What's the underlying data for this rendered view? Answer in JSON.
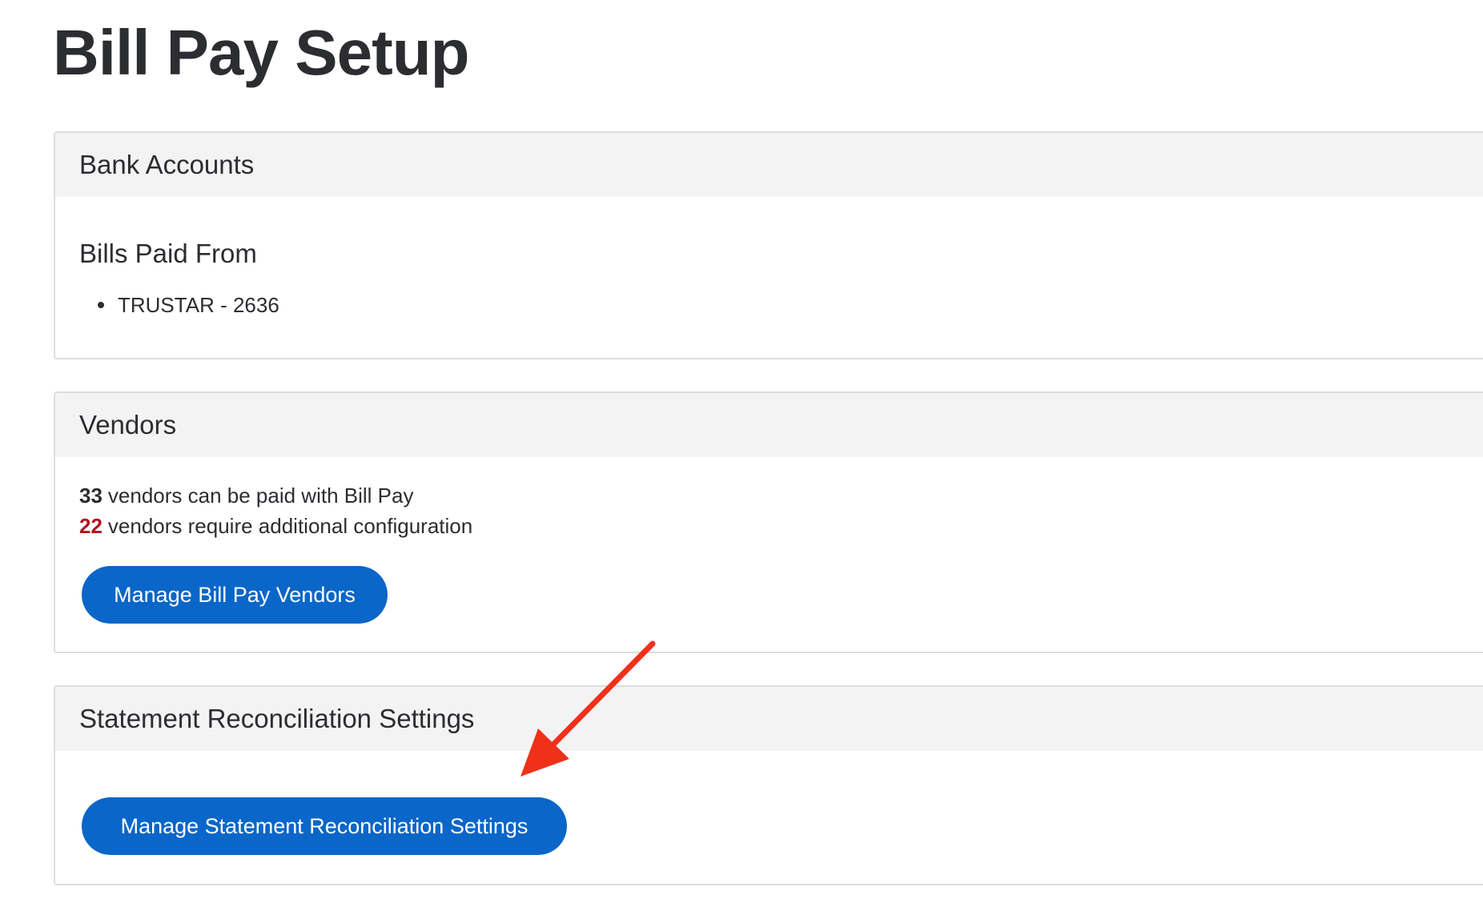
{
  "page": {
    "title": "Bill Pay Setup"
  },
  "bank_accounts": {
    "header": "Bank Accounts",
    "sub_heading": "Bills Paid From",
    "accounts": [
      "TRUSTAR - 2636"
    ]
  },
  "vendors": {
    "header": "Vendors",
    "payable_count": "33",
    "payable_text": "vendors can be paid with Bill Pay",
    "config_count": "22",
    "config_text": "vendors require additional configuration",
    "button_label": "Manage Bill Pay Vendors"
  },
  "statement_reconciliation": {
    "header": "Statement Reconciliation Settings",
    "button_label": "Manage Statement Reconciliation Settings"
  },
  "colors": {
    "primary": "#0a66c8",
    "warning_count": "#b0141f",
    "annotation_arrow": "#f0311a",
    "card_header_bg": "#f3f3f4"
  },
  "icons": {
    "annotation": "arrow-pointer-icon",
    "list_marker": "bullet-icon"
  }
}
